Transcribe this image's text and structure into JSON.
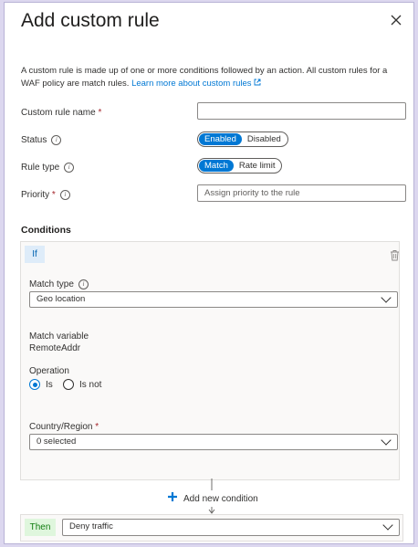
{
  "panel": {
    "title": "Add custom rule",
    "description": "A custom rule is made up of one or more conditions followed by an action. All custom rules for a WAF policy are match rules. ",
    "learn_more": "Learn more about custom rules"
  },
  "form": {
    "rule_name_label": "Custom rule name",
    "rule_name_value": "",
    "required_mark": "*",
    "status_label": "Status",
    "status_on": "Enabled",
    "status_off": "Disabled",
    "rule_type_label": "Rule type",
    "rule_type_on": "Match",
    "rule_type_off": "Rate limit",
    "priority_label": "Priority",
    "priority_placeholder": "Assign priority to the rule"
  },
  "conditions": {
    "heading": "Conditions",
    "if_label": "If",
    "match_type_label": "Match type",
    "match_type_value": "Geo location",
    "match_variable_label": "Match variable",
    "match_variable_value": "RemoteAddr",
    "operation_label": "Operation",
    "op_is": "Is",
    "op_is_not": "Is not",
    "country_label": "Country/Region",
    "country_value": "0 selected",
    "add_condition": "Add new condition"
  },
  "action": {
    "then_label": "Then",
    "value": "Deny traffic"
  },
  "colors": {
    "accent": "#0078d4",
    "required": "#a4262c",
    "then_badge": "#dff6dd",
    "if_badge": "#deecf9"
  }
}
